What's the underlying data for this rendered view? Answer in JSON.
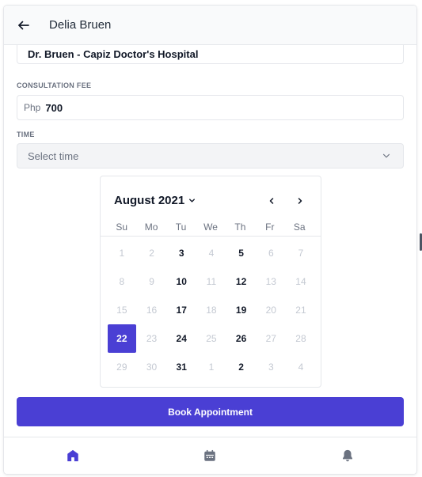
{
  "header": {
    "title": "Delia Bruen"
  },
  "hospital": {
    "value": "Dr. Bruen - Capiz Doctor's Hospital"
  },
  "fee": {
    "label": "CONSULTATION FEE",
    "prefix": "Php",
    "value": "700"
  },
  "time": {
    "label": "TIME",
    "placeholder": "Select time"
  },
  "calendar": {
    "month_label": "August 2021",
    "weekdays": [
      "Su",
      "Mo",
      "Tu",
      "We",
      "Th",
      "Fr",
      "Sa"
    ],
    "days": [
      {
        "label": "1",
        "state": "muted"
      },
      {
        "label": "2",
        "state": "muted"
      },
      {
        "label": "3",
        "state": "active"
      },
      {
        "label": "4",
        "state": "muted"
      },
      {
        "label": "5",
        "state": "active"
      },
      {
        "label": "6",
        "state": "muted"
      },
      {
        "label": "7",
        "state": "muted"
      },
      {
        "label": "8",
        "state": "muted"
      },
      {
        "label": "9",
        "state": "muted"
      },
      {
        "label": "10",
        "state": "active"
      },
      {
        "label": "11",
        "state": "muted"
      },
      {
        "label": "12",
        "state": "active"
      },
      {
        "label": "13",
        "state": "muted"
      },
      {
        "label": "14",
        "state": "muted"
      },
      {
        "label": "15",
        "state": "muted"
      },
      {
        "label": "16",
        "state": "muted"
      },
      {
        "label": "17",
        "state": "active"
      },
      {
        "label": "18",
        "state": "muted"
      },
      {
        "label": "19",
        "state": "active"
      },
      {
        "label": "20",
        "state": "muted"
      },
      {
        "label": "21",
        "state": "muted"
      },
      {
        "label": "22",
        "state": "selected"
      },
      {
        "label": "23",
        "state": "muted"
      },
      {
        "label": "24",
        "state": "active"
      },
      {
        "label": "25",
        "state": "muted"
      },
      {
        "label": "26",
        "state": "active"
      },
      {
        "label": "27",
        "state": "muted"
      },
      {
        "label": "28",
        "state": "muted"
      },
      {
        "label": "29",
        "state": "muted"
      },
      {
        "label": "30",
        "state": "muted"
      },
      {
        "label": "31",
        "state": "active"
      },
      {
        "label": "1",
        "state": "muted"
      },
      {
        "label": "2",
        "state": "active"
      },
      {
        "label": "3",
        "state": "muted"
      },
      {
        "label": "4",
        "state": "muted"
      }
    ]
  },
  "actions": {
    "book_label": "Book Appointment"
  },
  "bottom_nav": [
    {
      "icon": "home-icon",
      "active": true
    },
    {
      "icon": "calendar-icon",
      "active": false
    },
    {
      "icon": "bell-icon",
      "active": false
    }
  ],
  "colors": {
    "accent": "#4a3fd4",
    "muted_day": "#c4c9d2",
    "nav_inactive": "#6b7280"
  }
}
